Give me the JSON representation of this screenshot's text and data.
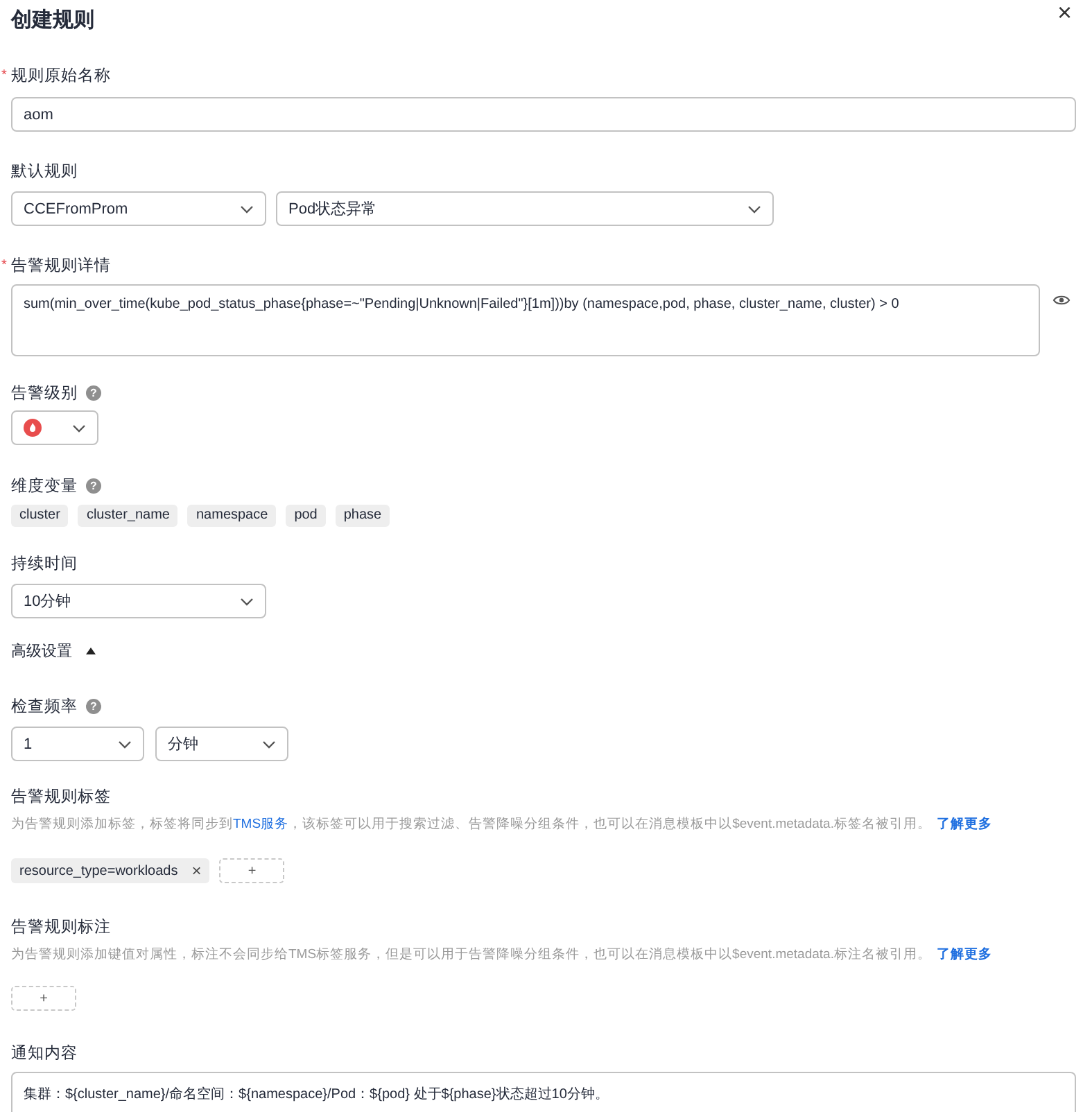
{
  "dialog": {
    "title": "创建规则",
    "close": "×"
  },
  "rule_name": {
    "label": "规则原始名称",
    "required_mark": "*",
    "value": "aom"
  },
  "default_rule": {
    "label": "默认规则",
    "selects": [
      "CCEFromProm",
      "Pod状态异常"
    ]
  },
  "detail": {
    "label": "告警规则详情",
    "required_mark": "*",
    "value": "sum(min_over_time(kube_pod_status_phase{phase=~\"Pending|Unknown|Failed\"}[1m]))by (namespace,pod, phase, cluster_name, cluster)  > 0"
  },
  "severity": {
    "label": "告警级别",
    "help": "?",
    "color": "#e84d4d"
  },
  "dimensions": {
    "label": "维度变量",
    "help": "?",
    "chips": [
      "cluster",
      "cluster_name",
      "namespace",
      "pod",
      "phase"
    ]
  },
  "duration": {
    "label": "持续时间",
    "value": "10分钟"
  },
  "advanced": {
    "label": "高级设置",
    "expanded": true
  },
  "frequency": {
    "label": "检查频率",
    "help": "?",
    "value": "1",
    "unit": "分钟"
  },
  "tags": {
    "label": "告警规则标签",
    "hint_before": "为告警规则添加标签，标签将同步到",
    "hint_link": "TMS服务",
    "hint_after": "，该标签可以用于搜索过滤、告警降噪分组条件，也可以在消息模板中以$event.metadata.标签名被引用。",
    "more": "了解更多",
    "items": [
      {
        "text": "resource_type=workloads",
        "remove": "×"
      }
    ],
    "add": "+"
  },
  "annotations": {
    "label": "告警规则标注",
    "hint": "为告警规则添加键值对属性，标注不会同步给TMS标签服务，但是可以用于告警降噪分组条件，也可以在消息模板中以$event.metadata.标注名被引用。",
    "more": "了解更多",
    "add": "+"
  },
  "notice": {
    "label": "通知内容",
    "value": "集群：${cluster_name}/命名空间：${namespace}/Pod：${pod} 处于${phase}状态超过10分钟。"
  }
}
